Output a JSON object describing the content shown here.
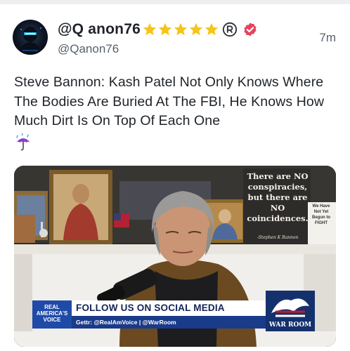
{
  "post": {
    "display_name": "@Q anon76",
    "handle": "@Qanon76",
    "time": "7m",
    "text": "Steve Bannon: Kash Patel Not Only Knows Where The Bodies Are Buried At The FBI, He Knows How Much Dirt Is On Top Of Each One",
    "emoji": "umbrella-with-rain-icon",
    "star_count": 5
  },
  "media": {
    "sign_text": "There are NO conspiracies, but there are NO coincidences.",
    "sign_signature": "-Stephen K Bannon",
    "small_sign_text": "We Have Not Yet Begun to FIGHT",
    "lower_third": {
      "network_line1": "REAL",
      "network_line2": "AMERICA'S",
      "network_line3": "VOICE",
      "headline": "FOLLOW US ON SOCIAL MEDIA",
      "subline": "Gettr: @RealAmVoice | @WarRoom"
    },
    "warroom_logo_text": "WAR ROOM"
  },
  "colors": {
    "accent_star": "#f5c518",
    "verified_badge": "#e8425d",
    "banner_blue": "#1a3a8a"
  }
}
